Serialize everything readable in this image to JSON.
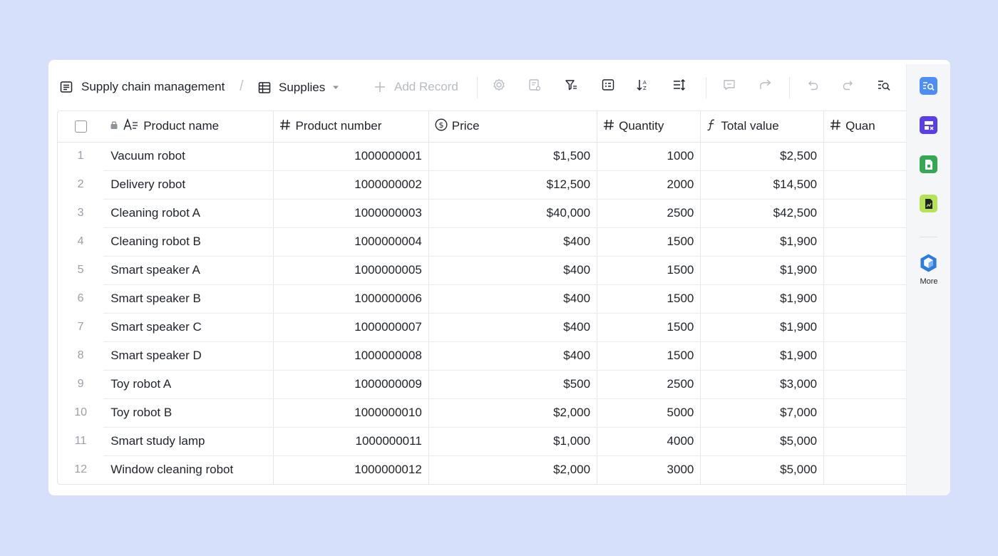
{
  "toolbar": {
    "doc_title": "Supply chain management",
    "table_name": "Supplies",
    "add_record": "Add Record",
    "icons": [
      "table-doc-icon",
      "grid-icon",
      "dropdown-caret-icon",
      "plus-icon",
      "settings-icon",
      "field-config-icon",
      "filter-icon",
      "group-icon",
      "sort-icon",
      "row-height-icon",
      "comment-icon",
      "share-icon",
      "undo-icon",
      "redo-icon",
      "search-icon"
    ]
  },
  "table": {
    "columns": {
      "name": "Product name",
      "number": "Product number",
      "price": "Price",
      "quantity": "Quantity",
      "total": "Total value",
      "extra": "Quan"
    },
    "rows": [
      {
        "idx": "1",
        "name": "Vacuum robot",
        "number": "1000000001",
        "price": "$1,500",
        "quantity": "1000",
        "total": "$2,500"
      },
      {
        "idx": "2",
        "name": "Delivery robot",
        "number": "1000000002",
        "price": "$12,500",
        "quantity": "2000",
        "total": "$14,500"
      },
      {
        "idx": "3",
        "name": "Cleaning robot A",
        "number": "1000000003",
        "price": "$40,000",
        "quantity": "2500",
        "total": "$42,500"
      },
      {
        "idx": "4",
        "name": "Cleaning robot B",
        "number": "1000000004",
        "price": "$400",
        "quantity": "1500",
        "total": "$1,900"
      },
      {
        "idx": "5",
        "name": "Smart speaker A",
        "number": "1000000005",
        "price": "$400",
        "quantity": "1500",
        "total": "$1,900"
      },
      {
        "idx": "6",
        "name": "Smart speaker B",
        "number": "1000000006",
        "price": "$400",
        "quantity": "1500",
        "total": "$1,900"
      },
      {
        "idx": "7",
        "name": "Smart speaker C",
        "number": "1000000007",
        "price": "$400",
        "quantity": "1500",
        "total": "$1,900"
      },
      {
        "idx": "8",
        "name": "Smart speaker D",
        "number": "1000000008",
        "price": "$400",
        "quantity": "1500",
        "total": "$1,900"
      },
      {
        "idx": "9",
        "name": "Toy robot A",
        "number": "1000000009",
        "price": "$500",
        "quantity": "2500",
        "total": "$3,000"
      },
      {
        "idx": "10",
        "name": "Toy robot B",
        "number": "1000000010",
        "price": "$2,000",
        "quantity": "5000",
        "total": "$7,000"
      },
      {
        "idx": "11",
        "name": "Smart study lamp",
        "number": "1000000011",
        "price": "$1,000",
        "quantity": "4000",
        "total": "$5,000"
      },
      {
        "idx": "12",
        "name": "Window cleaning robot",
        "number": "1000000012",
        "price": "$2,000",
        "quantity": "3000",
        "total": "$5,000"
      }
    ]
  },
  "side_panel": {
    "more_label": "More",
    "apps": [
      {
        "icon": "search-app-icon",
        "color": "#4d8ef6"
      },
      {
        "icon": "form-app-icon",
        "color": "#5b3ee8"
      },
      {
        "icon": "sheet-app-icon",
        "color": "#34a853"
      },
      {
        "icon": "chart-app-icon",
        "color": "#b5e354"
      }
    ],
    "more_icon": "more-apps-icon",
    "more_color": "#2c7be5"
  }
}
